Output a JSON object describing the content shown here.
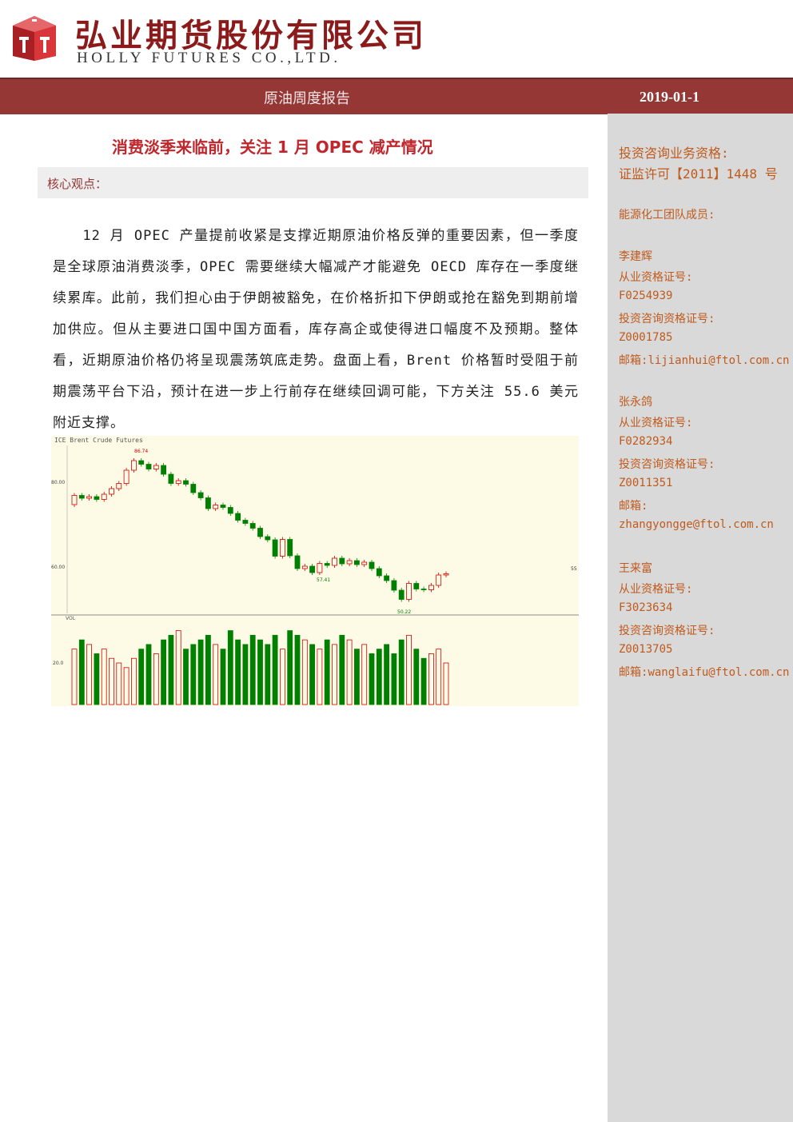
{
  "header": {
    "company_cn": "弘业期货股份有限公司",
    "company_en": "HOLLY FUTURES CO.,LTD."
  },
  "banner": {
    "report_type": "原油周度报告",
    "date": "2019-01-1"
  },
  "article": {
    "title": "消费淡季来临前，关注 1 月 OPEC 减产情况",
    "core_label": "核心观点：",
    "paragraph": "12 月 OPEC 产量提前收紧是支撑近期原油价格反弹的重要因素，但一季度是全球原油消费淡季，OPEC 需要继续大幅减产才能避免 OECD 库存在一季度继续累库。此前，我们担心由于伊朗被豁免，在价格折扣下伊朗或抢在豁免到期前增加供应。但从主要进口国中国方面看，库存高企或使得进口幅度不及预期。整体看，近期原油价格仍将呈现震荡筑底走势。盘面上看，Brent 价格暂时受阻于前期震荡平台下沿，预计在进一步上行前存在继续回调可能，下方关注 55.6 美元附近支撑。"
  },
  "sidebar": {
    "qual_title": "投资咨询业务资格:",
    "qual_value": "证监许可【2011】1448 号",
    "team_title": "能源化工团队成员:",
    "members": [
      {
        "name": "李建辉",
        "cert_label": "从业资格证号:",
        "cert": "F0254939",
        "inv_label": "投资咨询资格证号:",
        "inv": "Z0001785",
        "email_label": "邮箱:",
        "email": "lijianhui@ftol.com.cn"
      },
      {
        "name": "张永鸽",
        "cert_label": "从业资格证号:",
        "cert": "F0282934",
        "inv_label": "投资咨询资格证号:",
        "inv": "Z0011351",
        "email_label": "邮箱:",
        "email": "zhangyongge@ftol.com.cn"
      },
      {
        "name": "王来富",
        "cert_label": "从业资格证号:",
        "cert": "F3023634",
        "inv_label": "投资咨询资格证号:",
        "inv": "Z0013705",
        "email_label": "邮箱:",
        "email": "wanglaifu@ftol.com.cn"
      }
    ]
  },
  "colors": {
    "banner": "#953735",
    "title_red": "#c0272d",
    "sidebar_text": "#c05a1c",
    "candle_up": "#d40000",
    "candle_down": "#008000"
  },
  "chart_data": {
    "type": "candlestick",
    "header_text": "ICE Brent Crude Futures",
    "price_labels": {
      "high": "86.74",
      "low": "50.22",
      "mid_note": "57.41",
      "last": "55"
    },
    "y_ticks": [
      "80.00",
      "60.00"
    ],
    "ylim": [
      48,
      90
    ],
    "candles": [
      {
        "o": 75.2,
        "c": 77.5
      },
      {
        "o": 77.5,
        "c": 76.8
      },
      {
        "o": 76.8,
        "c": 77.2
      },
      {
        "o": 77.2,
        "c": 76.5
      },
      {
        "o": 76.5,
        "c": 77.8
      },
      {
        "o": 77.8,
        "c": 79.2
      },
      {
        "o": 79.2,
        "c": 80.5
      },
      {
        "o": 80.5,
        "c": 83.8
      },
      {
        "o": 83.8,
        "c": 86.2
      },
      {
        "o": 86.2,
        "c": 85.3
      },
      {
        "o": 85.3,
        "c": 84.1
      },
      {
        "o": 84.1,
        "c": 85.0
      },
      {
        "o": 85.0,
        "c": 82.8
      },
      {
        "o": 82.8,
        "c": 80.5
      },
      {
        "o": 80.5,
        "c": 81.2
      },
      {
        "o": 81.2,
        "c": 80.3
      },
      {
        "o": 80.3,
        "c": 78.2
      },
      {
        "o": 78.2,
        "c": 76.9
      },
      {
        "o": 76.9,
        "c": 74.2
      },
      {
        "o": 74.2,
        "c": 75.1
      },
      {
        "o": 75.1,
        "c": 74.5
      },
      {
        "o": 74.5,
        "c": 73.0
      },
      {
        "o": 73.0,
        "c": 71.3
      },
      {
        "o": 71.3,
        "c": 70.5
      },
      {
        "o": 70.5,
        "c": 69.3
      },
      {
        "o": 69.3,
        "c": 67.2
      },
      {
        "o": 67.2,
        "c": 66.4
      },
      {
        "o": 66.4,
        "c": 62.3
      },
      {
        "o": 62.3,
        "c": 66.5
      },
      {
        "o": 66.5,
        "c": 62.4
      },
      {
        "o": 62.4,
        "c": 59.2
      },
      {
        "o": 59.2,
        "c": 59.8
      },
      {
        "o": 59.8,
        "c": 58.2
      },
      {
        "o": 58.2,
        "c": 60.5
      },
      {
        "o": 60.5,
        "c": 60.0
      },
      {
        "o": 60.0,
        "c": 61.8
      },
      {
        "o": 61.8,
        "c": 60.4
      },
      {
        "o": 60.4,
        "c": 61.2
      },
      {
        "o": 61.2,
        "c": 60.2
      },
      {
        "o": 60.2,
        "c": 60.8
      },
      {
        "o": 60.8,
        "c": 59.2
      },
      {
        "o": 59.2,
        "c": 57.4
      },
      {
        "o": 57.4,
        "c": 56.2
      },
      {
        "o": 56.2,
        "c": 53.8
      },
      {
        "o": 53.8,
        "c": 51.5
      },
      {
        "o": 51.5,
        "c": 55.5
      },
      {
        "o": 55.5,
        "c": 54.1
      },
      {
        "o": 54.1,
        "c": 53.9
      },
      {
        "o": 53.9,
        "c": 55.0
      },
      {
        "o": 55.0,
        "c": 57.6
      },
      {
        "o": 57.6,
        "c": 57.9
      }
    ],
    "volume_header": "VOL",
    "volume_tick": "20.0",
    "volumes": [
      12,
      14,
      13,
      11,
      12,
      10,
      9,
      8,
      10,
      12,
      13,
      11,
      14,
      15,
      16,
      12,
      13,
      14,
      15,
      13,
      12,
      16,
      14,
      13,
      15,
      14,
      13,
      15,
      12,
      16,
      15,
      14,
      13,
      12,
      14,
      13,
      15,
      14,
      12,
      13,
      11,
      12,
      13,
      11,
      14,
      15,
      12,
      10,
      11,
      12,
      9
    ]
  }
}
